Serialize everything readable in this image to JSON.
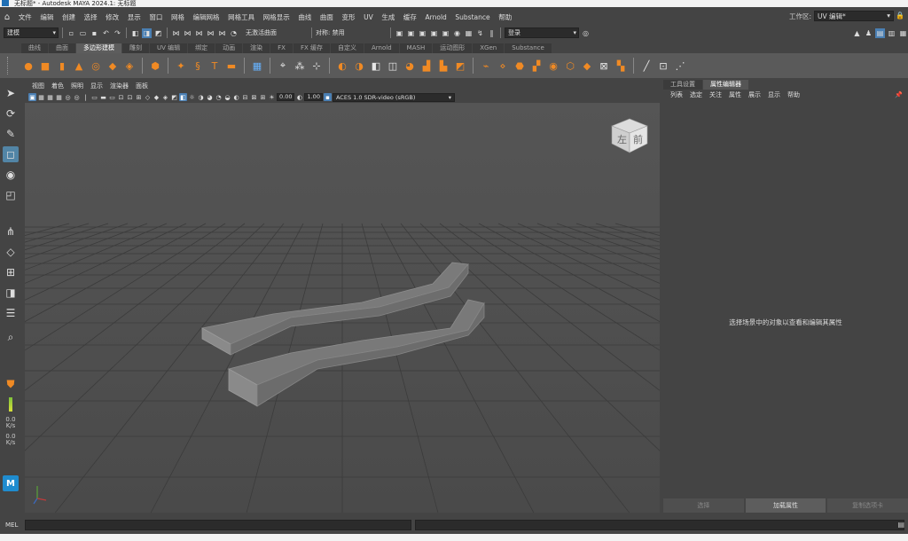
{
  "title": "无标题* - Autodesk MAYA 2024.1: 无标题",
  "menu": [
    "文件",
    "编辑",
    "创建",
    "选择",
    "修改",
    "显示",
    "窗口",
    "网格",
    "编辑网格",
    "网格工具",
    "网格显示",
    "曲线",
    "曲面",
    "变形",
    "UV",
    "生成",
    "缓存",
    "Arnold",
    "Substance",
    "帮助"
  ],
  "workspace": {
    "label": "工作区:",
    "value": "UV 编辑*"
  },
  "status_line": {
    "mode_combo": "建模",
    "live_surface": "无激活曲面",
    "symmetry": "对称: 禁用",
    "login": "登录"
  },
  "shelf_tabs": [
    "曲线",
    "曲面",
    "多边形建模",
    "雕刻",
    "UV 编辑",
    "绑定",
    "动画",
    "渲染",
    "FX",
    "FX 缓存",
    "自定义",
    "Arnold",
    "MASH",
    "运动图形",
    "XGen",
    "Substance"
  ],
  "shelf_active": "多边形建模",
  "viewport_menu": [
    "视图",
    "着色",
    "照明",
    "显示",
    "渲染器",
    "面板"
  ],
  "viewport_toolbar": {
    "exposure": "0.00",
    "gamma": "1.00",
    "color_space": "ACES 1.0 SDR-video (sRGB)"
  },
  "view_cube": {
    "left": "左",
    "front": "前"
  },
  "right_panel": {
    "tabs": [
      "工具设置",
      "属性编辑器"
    ],
    "active_tab": "属性编辑器",
    "menu": [
      "列表",
      "选定",
      "关注",
      "属性",
      "展示",
      "显示",
      "帮助"
    ],
    "message": "选择场景中的对象以查看和编辑其属性",
    "buttons": [
      "选择",
      "加载属性",
      "复制选项卡"
    ]
  },
  "toolbox_readouts": [
    {
      "value": "0.0",
      "unit": "K/s"
    },
    {
      "value": "0.0",
      "unit": "K/s"
    }
  ],
  "mel_label": "MEL",
  "maya_logo": "M"
}
